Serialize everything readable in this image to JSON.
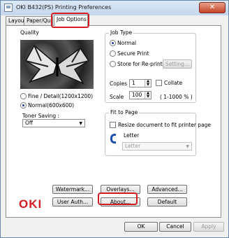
{
  "window": {
    "title": "OKI B432(PS) Printing Preferences",
    "close_glyph": "✕"
  },
  "tabs": [
    {
      "label": "Layout"
    },
    {
      "label": "Paper/Qualit"
    },
    {
      "label": "Job Options"
    }
  ],
  "quality": {
    "group_label": "Quality",
    "options": [
      {
        "label": "Fine / Detail(1200x1200)",
        "selected": false
      },
      {
        "label": "Normal(600x600)",
        "selected": true
      }
    ],
    "toner_label": "Toner Saving :",
    "toner_value": "Off"
  },
  "job_type": {
    "group_label": "Job Type",
    "options": [
      {
        "label": "Normal",
        "selected": true
      },
      {
        "label": "Secure Print",
        "selected": false
      },
      {
        "label": "Store for Re-print",
        "selected": false
      }
    ],
    "setting_button": "Setting...",
    "copies_label": "Copies",
    "copies_value": "1",
    "collate_label": "Collate",
    "scale_label": "Scale",
    "scale_value": "100",
    "scale_range": "( 1-1000 % )"
  },
  "fit_to_page": {
    "group_label": "Fit to Page",
    "resize_label": "Resize document to fit printer page",
    "paper_label": "Letter",
    "paper_select": "Letter"
  },
  "buttons": {
    "watermark": "Watermark...",
    "overlays": "Overlays...",
    "advanced": "Advanced...",
    "user_auth": "User Auth...",
    "about": "About...",
    "default": "Default"
  },
  "brand": {
    "logo": "OKI",
    "color": "#d51b22"
  },
  "footer": {
    "ok": "OK",
    "cancel": "Cancel",
    "apply": "Apply"
  }
}
